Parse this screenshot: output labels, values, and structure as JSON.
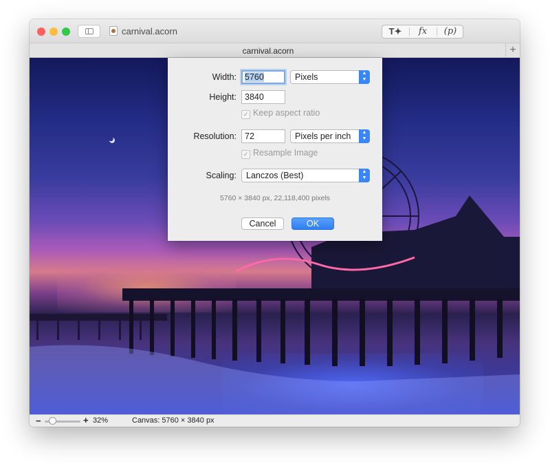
{
  "window": {
    "title": "carnival.acorn",
    "tab_title": "carnival.acorn",
    "toolbar": {
      "tools": [
        {
          "label": "T✦",
          "icon": "text-tools-icon"
        },
        {
          "label": "fx",
          "icon": "fx-icon"
        },
        {
          "label": "(p)",
          "icon": "plugin-icon"
        }
      ],
      "add_tab_label": "+"
    }
  },
  "status": {
    "zoom_minus": "−",
    "zoom_plus": "+",
    "zoom_level": "32%",
    "zoom_fraction": 0.32,
    "canvas_size": "Canvas: 5760 × 3840 px"
  },
  "dialog": {
    "width_label": "Width:",
    "width_value": "5760",
    "height_label": "Height:",
    "height_value": "3840",
    "unit_option": "Pixels",
    "keep_aspect_label": "Keep aspect ratio",
    "keep_aspect_checked": true,
    "resolution_label": "Resolution:",
    "resolution_value": "72",
    "resolution_unit": "Pixels per inch",
    "resample_label": "Resample Image",
    "resample_checked": true,
    "scaling_label": "Scaling:",
    "scaling_value": "Lanczos (Best)",
    "info": "5760 × 3840 px, 22,118,400 pixels",
    "cancel_label": "Cancel",
    "ok_label": "OK"
  },
  "colors": {
    "accent": "#3b86f7",
    "close": "#fc615d",
    "minimize": "#fdbc40",
    "zoom": "#34c84a"
  }
}
